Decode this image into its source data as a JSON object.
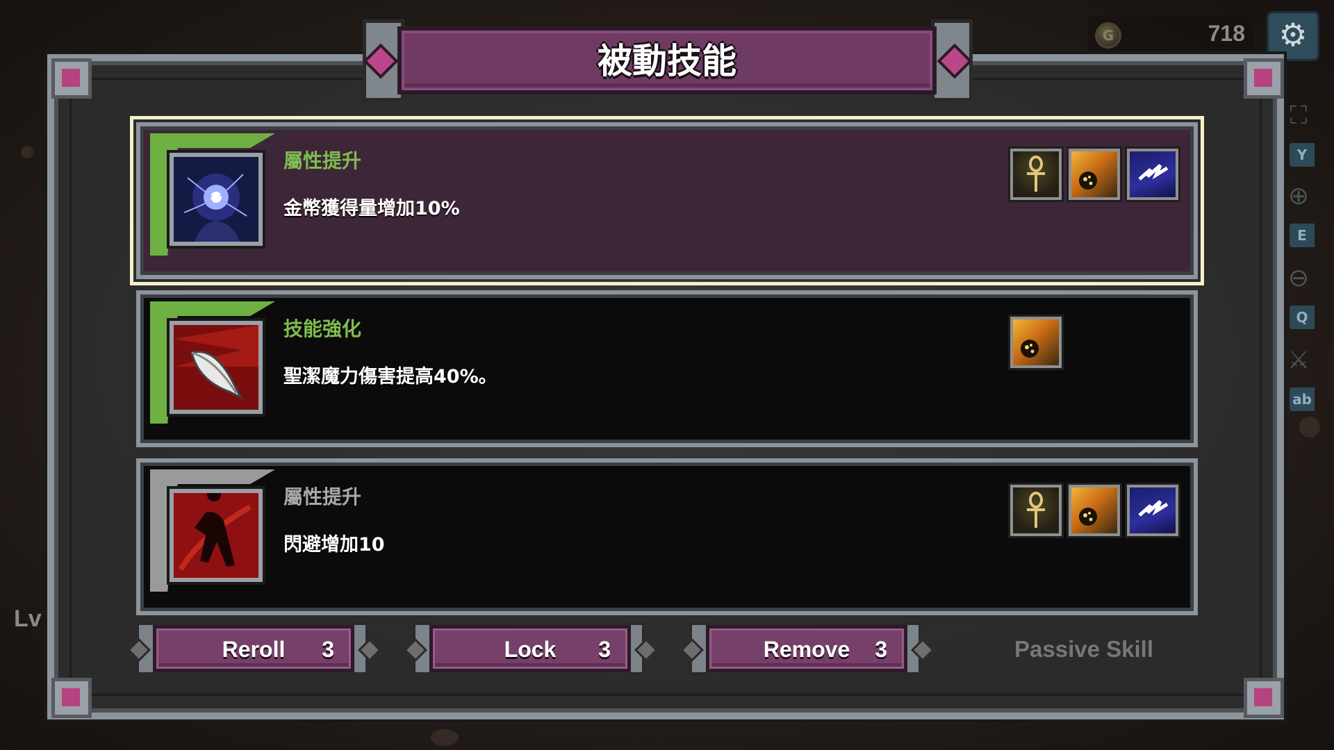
{
  "hud": {
    "gold": "718",
    "side_buttons": [
      "Y",
      "E",
      "Q",
      "ab"
    ],
    "level_label": "Lv"
  },
  "dialog": {
    "title": "被動技能",
    "skills": [
      {
        "category": "屬性提升",
        "description": "金幣獲得量增加10%",
        "category_color": "#7ebd4f",
        "selected": true,
        "related_icons": [
          "ankh-icon",
          "meteor-icon",
          "lightning-icon"
        ]
      },
      {
        "category": "技能強化",
        "description": "聖潔魔力傷害提高40%。",
        "category_color": "#7ebd4f",
        "selected": false,
        "related_icons": [
          "meteor-icon"
        ]
      },
      {
        "category": "屬性提升",
        "description": "閃避增加10",
        "category_color": "#a8a8a8",
        "selected": false,
        "related_icons": [
          "ankh-icon",
          "meteor-icon",
          "lightning-icon"
        ]
      }
    ],
    "actions": {
      "reroll": {
        "label": "Reroll",
        "count": "3"
      },
      "lock": {
        "label": "Lock",
        "count": "3"
      },
      "remove": {
        "label": "Remove",
        "count": "3"
      }
    },
    "footer_label": "Passive Skill"
  },
  "colors": {
    "accent_purple": "#76406a",
    "selected_outline": "#f6f0c8",
    "frame_gray": "#8d949b",
    "green_tab": "#6fb043",
    "gray_tab": "#9a9a9a"
  }
}
